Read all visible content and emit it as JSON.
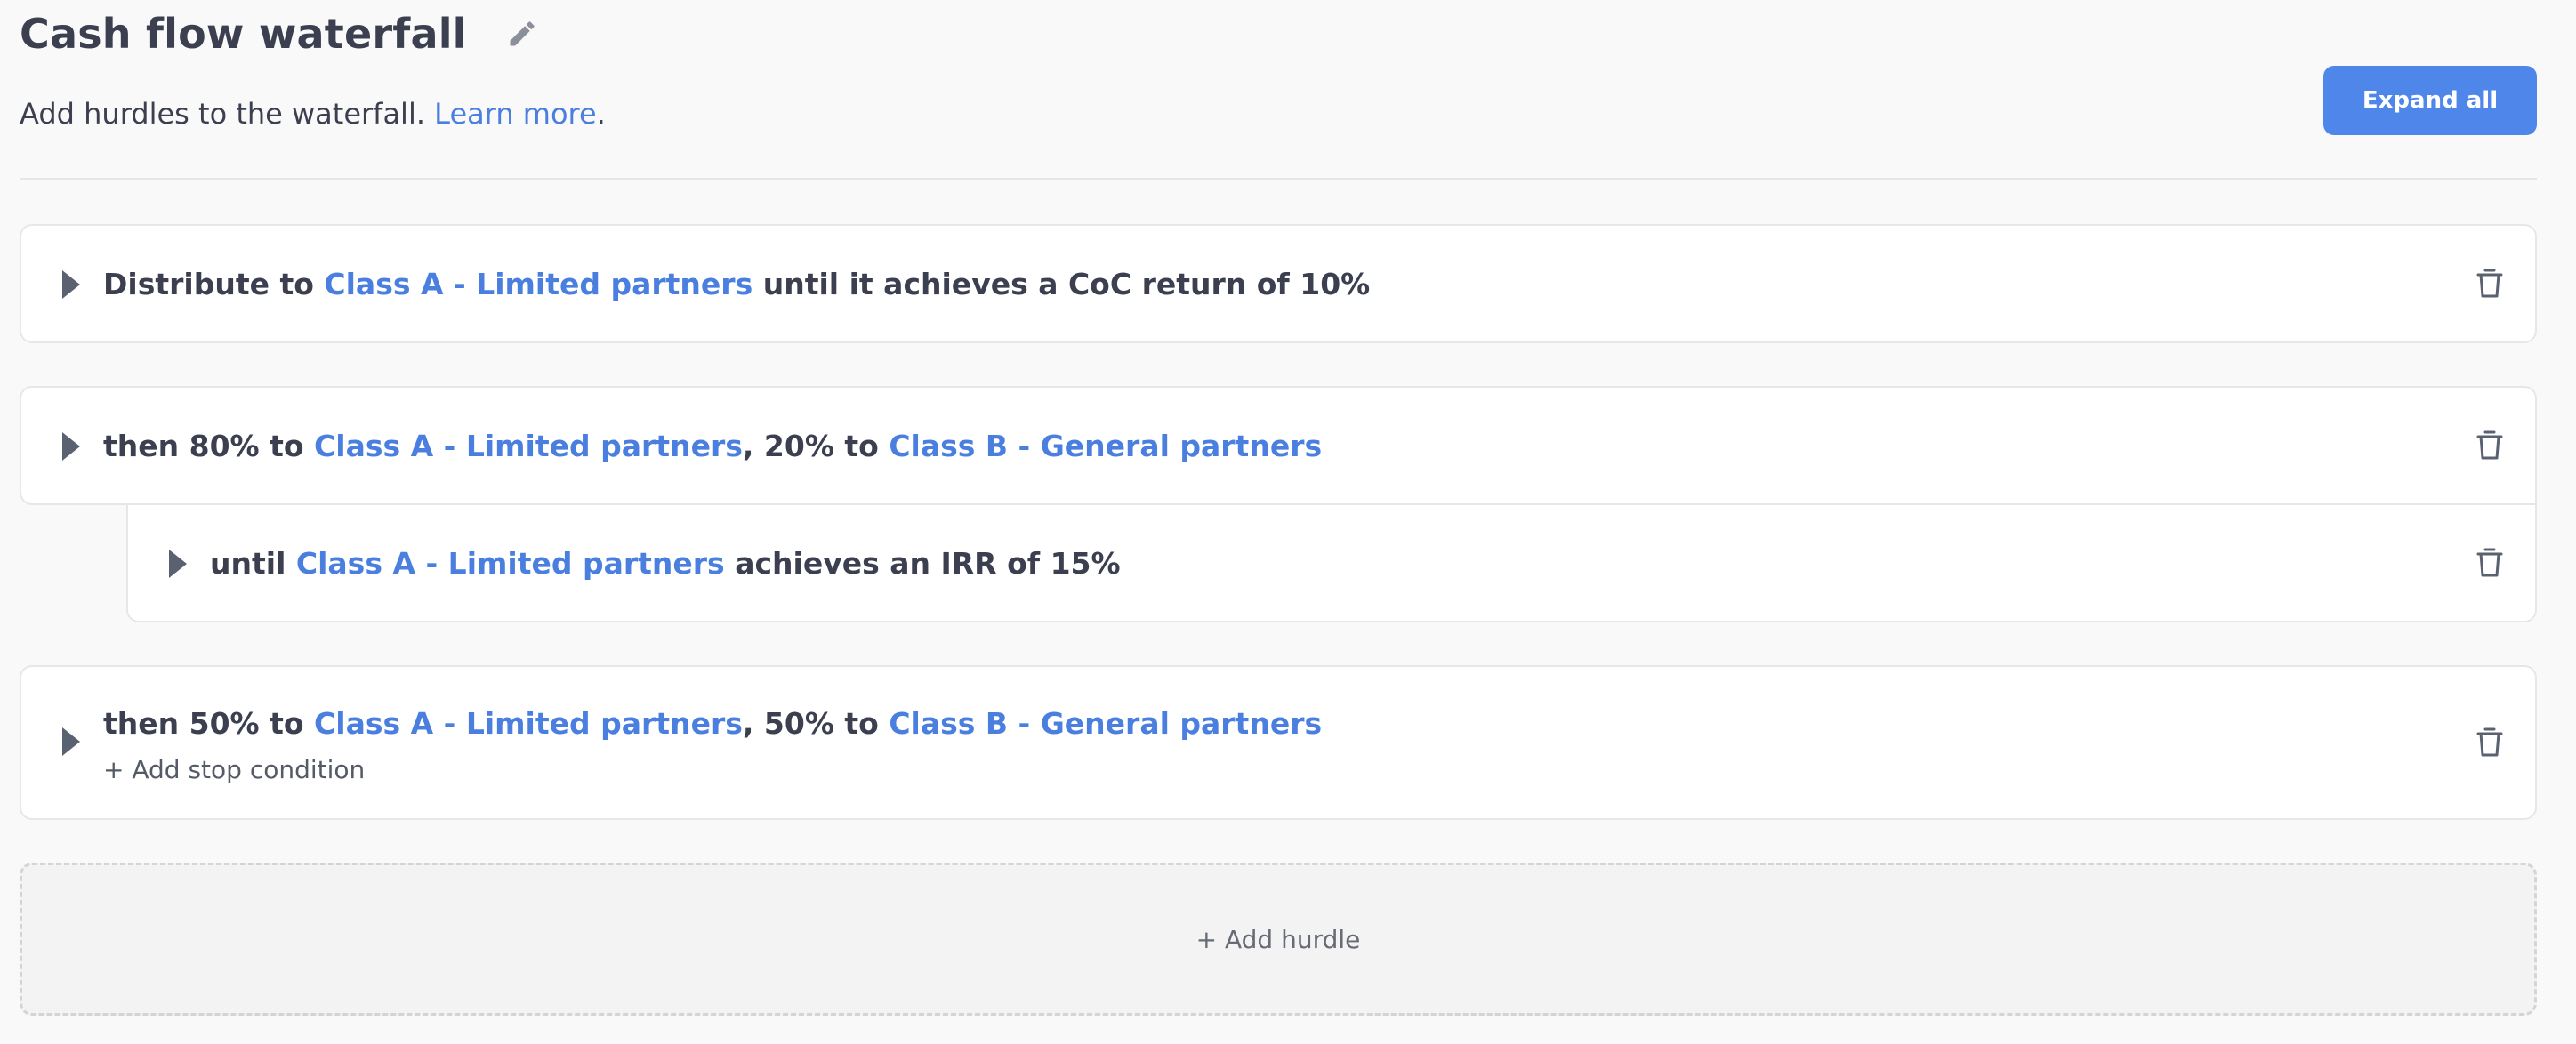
{
  "header": {
    "title": "Cash flow waterfall",
    "subtitle_prefix": "Add hurdles to the waterfall. ",
    "learn_more": "Learn more",
    "subtitle_suffix": ".",
    "expand_all": "Expand all"
  },
  "hurdles": [
    {
      "parts": [
        "Distribute to ",
        "Class A - Limited partners",
        " until it achieves a CoC return of 10%"
      ]
    },
    {
      "parts": [
        "then 80% to ",
        "Class A - Limited partners",
        ", 20% to ",
        "Class B - General partners"
      ],
      "condition": {
        "parts": [
          "until ",
          "Class A - Limited partners",
          " achieves an IRR of 15%"
        ]
      }
    },
    {
      "parts": [
        "then 50% to ",
        "Class A - Limited partners",
        ", 50% to ",
        "Class B - General partners"
      ],
      "add_stop_condition": "+ Add stop condition"
    }
  ],
  "add_hurdle": "+ Add hurdle",
  "colors": {
    "accent": "#4a7fe0",
    "button": "#4f86ea",
    "text": "#3b3f50"
  }
}
